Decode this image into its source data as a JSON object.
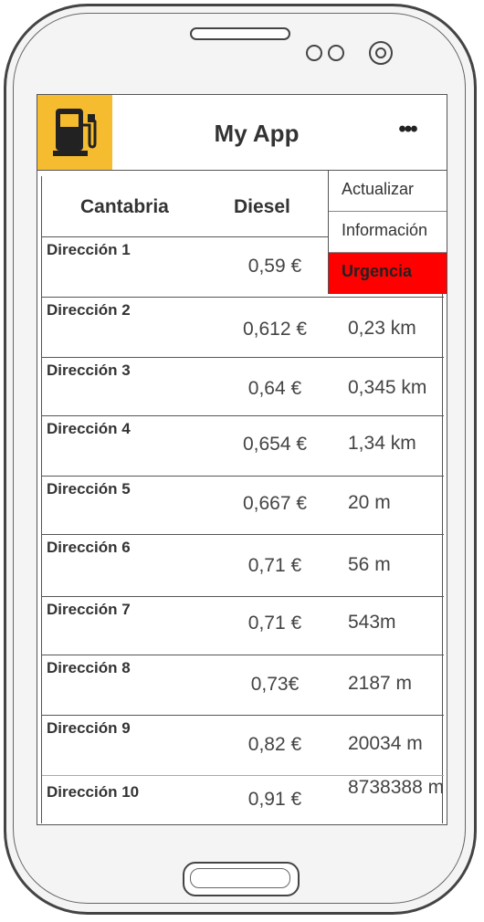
{
  "app": {
    "title": "My App",
    "menu_icon": "more-dots-icon",
    "logo_icon": "fuel-pump-icon",
    "logo_bg": "#f5bc2f"
  },
  "table": {
    "headers": {
      "region": "Cantabria",
      "fuel": "Diesel"
    },
    "rows": [
      {
        "address": "Dirección 1",
        "price": "0,59 €",
        "distance": ""
      },
      {
        "address": "Dirección 2",
        "price": "0,612 €",
        "distance": "0,23 km"
      },
      {
        "address": "Dirección 3",
        "price": "0,64 €",
        "distance": "0,345 km"
      },
      {
        "address": "Dirección 4",
        "price": "0,654 €",
        "distance": "1,34 km"
      },
      {
        "address": "Dirección 5",
        "price": "0,667 €",
        "distance": "20 m"
      },
      {
        "address": "Dirección 6",
        "price": "0,71 €",
        "distance": "56 m"
      },
      {
        "address": "Dirección 7",
        "price": "0,71 €",
        "distance": "543m"
      },
      {
        "address": "Dirección 8",
        "price": "0,73€",
        "distance": "2187 m"
      },
      {
        "address": "Dirección 9",
        "price": "0,82 €",
        "distance": "20034 m"
      },
      {
        "address": "Dirección 10",
        "price": "0,91 €",
        "distance": "8738388 m"
      }
    ]
  },
  "menu": {
    "items": [
      {
        "label": "Actualizar"
      },
      {
        "label": "Información"
      },
      {
        "label": "Urgencia",
        "color": "#ff0000"
      }
    ]
  }
}
